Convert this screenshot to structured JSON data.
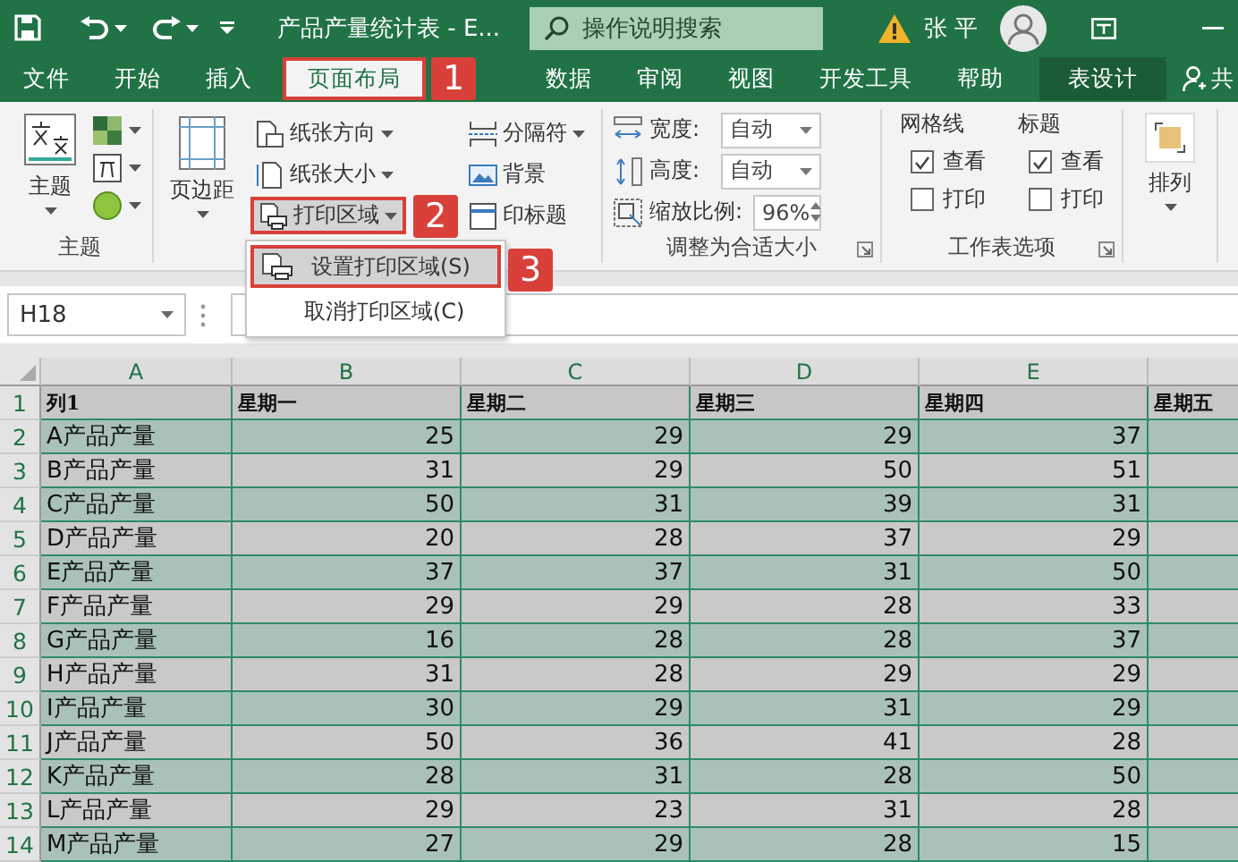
{
  "title_bar": {
    "title": "产品产量统计表 - E...",
    "search": {
      "placeholder": "操作说明搜索"
    },
    "user": "张 平"
  },
  "ribbon_tabs": [
    {
      "label": "文件",
      "selected": false,
      "contextual": false
    },
    {
      "label": "开始",
      "selected": false,
      "contextual": false
    },
    {
      "label": "插入",
      "selected": false,
      "contextual": false
    },
    {
      "label": "页面布局",
      "selected": true,
      "contextual": false,
      "callout": "1"
    },
    {
      "label": "数据",
      "selected": false,
      "contextual": false
    },
    {
      "label": "审阅",
      "selected": false,
      "contextual": false
    },
    {
      "label": "视图",
      "selected": false,
      "contextual": false
    },
    {
      "label": "开发工具",
      "selected": false,
      "contextual": false
    },
    {
      "label": "帮助",
      "selected": false,
      "contextual": false
    },
    {
      "label": "表设计",
      "selected": false,
      "contextual": true
    }
  ],
  "share": "共",
  "ribbon": {
    "groups": [
      {
        "kind": "themes",
        "label": "主题",
        "big_button": "主题"
      },
      {
        "kind": "page_setup",
        "big_button": "页边距",
        "buttons": [
          {
            "label": "纸张方向",
            "dropdown": true,
            "highlighted": false
          },
          {
            "label": "纸张大小",
            "dropdown": true,
            "highlighted": false
          },
          {
            "label": "打印区域",
            "dropdown": true,
            "highlighted": true,
            "callout": "2"
          },
          {
            "label": "分隔符",
            "dropdown": true,
            "highlighted": false
          },
          {
            "label": "背景",
            "dropdown": false,
            "highlighted": false
          },
          {
            "label": "印标题",
            "dropdown": false,
            "highlighted": false
          }
        ],
        "menu": {
          "items": [
            {
              "label": "设置打印区域(S)",
              "selected": true,
              "callout": "3"
            },
            {
              "label": "取消打印区域(C)",
              "selected": false
            }
          ]
        }
      },
      {
        "kind": "scale",
        "label": "调整为合适大小",
        "fields": [
          {
            "label": "宽度:",
            "value": "自动",
            "kind": "select"
          },
          {
            "label": "高度:",
            "value": "自动",
            "kind": "select"
          },
          {
            "label": "缩放比例:",
            "value": "96%",
            "kind": "spin"
          }
        ]
      },
      {
        "kind": "sheet_options",
        "label": "工作表选项",
        "columns": [
          {
            "title": "网格线",
            "options": [
              {
                "label": "查看",
                "checked": true
              },
              {
                "label": "打印",
                "checked": false
              }
            ]
          },
          {
            "title": "标题",
            "options": [
              {
                "label": "查看",
                "checked": true
              },
              {
                "label": "打印",
                "checked": false
              }
            ]
          }
        ]
      },
      {
        "kind": "arrange",
        "big_button": "排列"
      }
    ]
  },
  "formula_bar": {
    "name_box": "H18"
  },
  "sheet": {
    "columns": [
      "A",
      "B",
      "C",
      "D",
      "E"
    ],
    "rows": [
      {
        "number": "1",
        "kind": "header",
        "cells": [
          "列1",
          "星期一",
          "星期二",
          "星期三",
          "星期四",
          "星期五"
        ]
      },
      {
        "number": "2",
        "kind": "data",
        "cells": [
          "A产品产量",
          "25",
          "29",
          "29",
          "37"
        ]
      },
      {
        "number": "3",
        "kind": "data",
        "cells": [
          "B产品产量",
          "31",
          "29",
          "50",
          "51"
        ]
      },
      {
        "number": "4",
        "kind": "data",
        "cells": [
          "C产品产量",
          "50",
          "31",
          "39",
          "31"
        ]
      },
      {
        "number": "5",
        "kind": "data",
        "cells": [
          "D产品产量",
          "20",
          "28",
          "37",
          "29"
        ]
      },
      {
        "number": "6",
        "kind": "data",
        "cells": [
          "E产品产量",
          "37",
          "37",
          "31",
          "50"
        ]
      },
      {
        "number": "7",
        "kind": "data",
        "cells": [
          "F产品产量",
          "29",
          "29",
          "28",
          "33"
        ]
      },
      {
        "number": "8",
        "kind": "data",
        "cells": [
          "G产品产量",
          "16",
          "28",
          "28",
          "37"
        ]
      },
      {
        "number": "9",
        "kind": "data",
        "cells": [
          "H产品产量",
          "31",
          "28",
          "29",
          "29"
        ]
      },
      {
        "number": "10",
        "kind": "data",
        "cells": [
          "I产品产量",
          "30",
          "29",
          "31",
          "29"
        ]
      },
      {
        "number": "11",
        "kind": "data",
        "cells": [
          "J产品产量",
          "50",
          "36",
          "41",
          "28"
        ]
      },
      {
        "number": "12",
        "kind": "data",
        "cells": [
          "K产品产量",
          "28",
          "31",
          "28",
          "50"
        ]
      },
      {
        "number": "13",
        "kind": "data",
        "cells": [
          "L产品产量",
          "29",
          "23",
          "31",
          "28"
        ]
      },
      {
        "number": "14",
        "kind": "data",
        "cells": [
          "M产品产量",
          "27",
          "29",
          "28",
          "15"
        ]
      }
    ]
  }
}
